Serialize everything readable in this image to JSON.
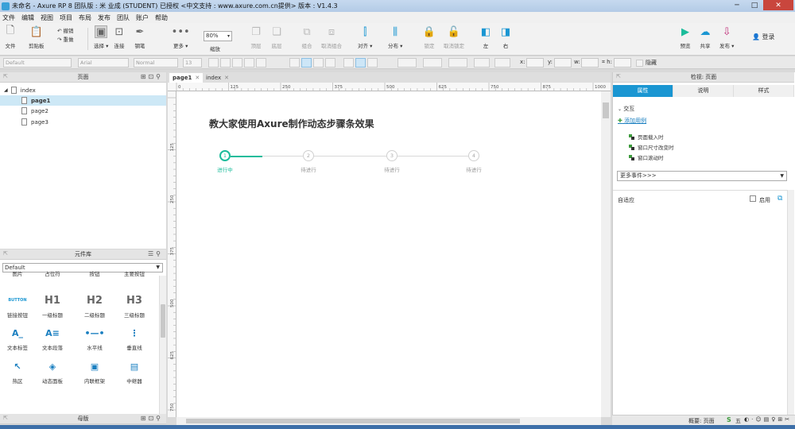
{
  "window": {
    "title": "未命名 - Axure RP 8 团队版 : 米 业成 (STUDENT) 已授权    <中文支持 : www.axure.com.cn提供> 版本 : V1.4.3"
  },
  "menu": [
    "文件",
    "编辑",
    "视图",
    "项目",
    "布局",
    "发布",
    "团队",
    "账户",
    "帮助"
  ],
  "toolbar": {
    "file": "文件",
    "clipboard": "剪贴板",
    "undo": "撤销",
    "redo": "重做",
    "select": "选择",
    "connect": "连接",
    "pen": "钢笔",
    "more": "更多",
    "zoom_value": "80%",
    "zoom_label": "缩放",
    "top": "顶层",
    "bottom": "底层",
    "group": "组合",
    "ungroup": "取消组合",
    "align": "对齐",
    "distribute": "分布",
    "lock": "锁定",
    "unlock": "取消锁定",
    "left": "左",
    "right": "右",
    "preview": "预览",
    "share": "共享",
    "publish": "发布",
    "login": "登录"
  },
  "formatbar": {
    "style": "Default",
    "font": "Arial",
    "weight": "Normal",
    "size": "13",
    "x_label": "x:",
    "y_label": "y:",
    "w_label": "w:",
    "h_label": "h:",
    "hidden_label": "隐藏"
  },
  "pages_panel": {
    "title": "页面",
    "items": [
      {
        "label": "index"
      },
      {
        "label": "page1"
      },
      {
        "label": "page2"
      },
      {
        "label": "page3"
      }
    ]
  },
  "widgets_panel": {
    "title": "元件库",
    "library": "Default",
    "widgets": [
      {
        "label": "图片",
        "icon": "image-icon",
        "glyph": ""
      },
      {
        "label": "占位符",
        "icon": "placeholder-icon",
        "glyph": ""
      },
      {
        "label": "按钮",
        "icon": "button-icon",
        "glyph": ""
      },
      {
        "label": "主要按钮",
        "icon": "primary-button-icon",
        "glyph": ""
      },
      {
        "label": "链接按钮",
        "icon": "link-button-icon",
        "glyph": "BUTTON"
      },
      {
        "label": "一级标题",
        "icon": "h1-icon",
        "glyph": "H1"
      },
      {
        "label": "二级标题",
        "icon": "h2-icon",
        "glyph": "H2"
      },
      {
        "label": "三级标题",
        "icon": "h3-icon",
        "glyph": "H3"
      },
      {
        "label": "文本标签",
        "icon": "text-label-icon",
        "glyph": "A_"
      },
      {
        "label": "文本段落",
        "icon": "paragraph-icon",
        "glyph": "A≡"
      },
      {
        "label": "水平线",
        "icon": "horizontal-line-icon",
        "glyph": "•—•"
      },
      {
        "label": "垂直线",
        "icon": "vertical-line-icon",
        "glyph": "⋮"
      },
      {
        "label": "热区",
        "icon": "hotspot-icon",
        "glyph": "↖"
      },
      {
        "label": "动态面板",
        "icon": "dynamic-panel-icon",
        "glyph": "◈"
      },
      {
        "label": "内联框架",
        "icon": "inline-frame-icon",
        "glyph": "▣"
      },
      {
        "label": "中继器",
        "icon": "repeater-icon",
        "glyph": "▤"
      }
    ]
  },
  "masters_panel": {
    "title": "母版"
  },
  "canvas": {
    "tabs": [
      {
        "label": "page1",
        "close": "✕"
      },
      {
        "label": "index",
        "close": "✕"
      }
    ],
    "ruler_h": [
      "0",
      "125",
      "250",
      "375",
      "500",
      "625",
      "750",
      "875",
      "1000"
    ],
    "ruler_v": [
      "125",
      "250",
      "375",
      "500",
      "625",
      "750"
    ],
    "heading": "教大家使用Axure制作动态步骤条效果",
    "steps": [
      {
        "number": "1",
        "label": "进行中",
        "active": true
      },
      {
        "number": "2",
        "label": "待进行",
        "active": false
      },
      {
        "number": "3",
        "label": "待进行",
        "active": false
      },
      {
        "number": "4",
        "label": "待进行",
        "active": false
      }
    ]
  },
  "inspector": {
    "title": "检视: 页面",
    "tabs": [
      "属性",
      "说明",
      "样式"
    ],
    "section": "交互",
    "add_case": "添加用例",
    "events": [
      "页面载入时",
      "窗口尺寸改变时",
      "窗口滚动时"
    ],
    "more_events": "更多事件>>>",
    "adaptive": "自适应",
    "enable": "启用"
  },
  "statusbar": {
    "overview": "概要: 页面",
    "ime": "五"
  },
  "colors": {
    "accent": "#1bbc9b",
    "tab_active": "#1a96d2"
  }
}
